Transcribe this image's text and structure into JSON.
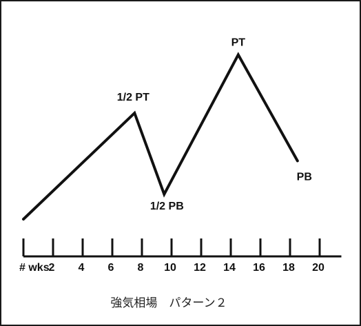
{
  "chart_data": {
    "type": "line",
    "title": "",
    "caption": "強気相場　パターン２",
    "xlabel": "# wks",
    "ylabel": "",
    "x_ticks": [
      "",
      "2",
      "4",
      "6",
      "8",
      "10",
      "12",
      "14",
      "16",
      "18",
      "20"
    ],
    "x_tick_values": [
      0,
      2,
      4,
      6,
      8,
      10,
      12,
      14,
      16,
      18,
      20
    ],
    "xlim": [
      0,
      21
    ],
    "x": [
      0,
      7.5,
      9.5,
      14.5,
      18.5
    ],
    "y": [
      0,
      51,
      12,
      79,
      28
    ],
    "ylim": [
      0,
      100
    ],
    "point_labels": [
      "",
      "1/2 PT",
      "1/2 PB",
      "PT",
      "PB"
    ],
    "grid": false,
    "legend": "none"
  },
  "colors": {
    "ink": "#111111",
    "background": "#ffffff",
    "border": "#1a1a1a"
  }
}
